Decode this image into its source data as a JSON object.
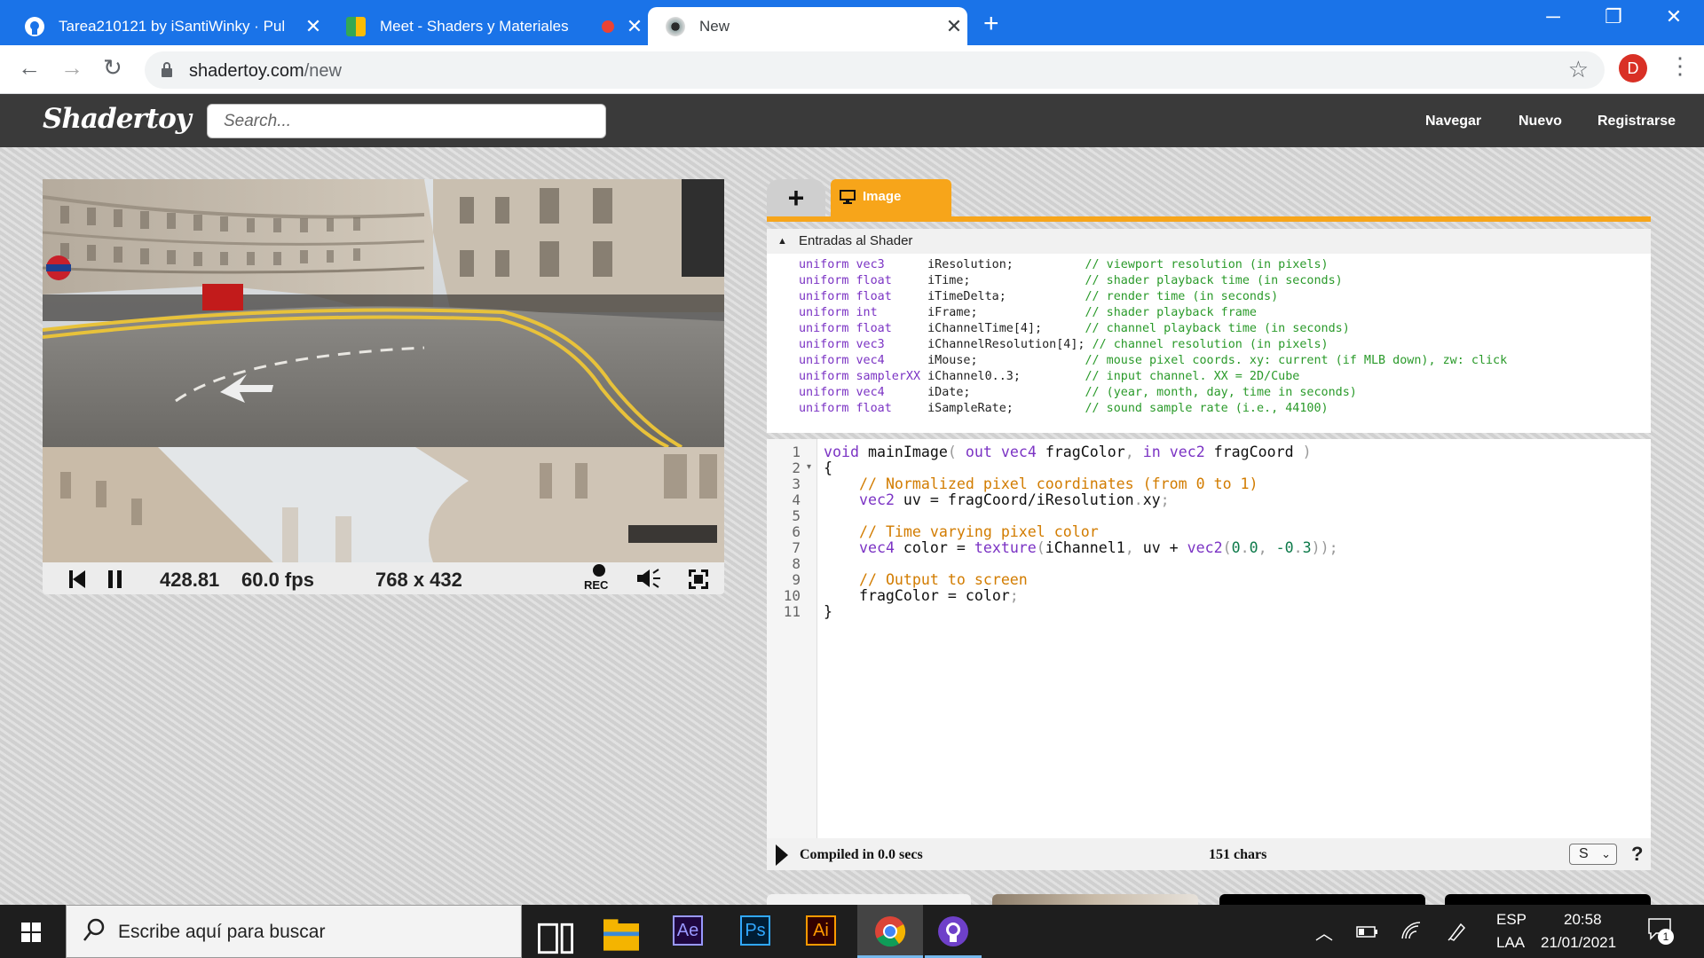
{
  "browser": {
    "tabs": [
      {
        "title": "Tarea210121 by iSantiWinky · Pul",
        "icon": "github-icon",
        "close": "✕"
      },
      {
        "title": "Meet - Shaders y Materiales",
        "icon": "google-meet-icon",
        "close": "✕"
      },
      {
        "title": "New",
        "icon": "shadertoy-icon",
        "close": "✕"
      }
    ],
    "new_tab": "+",
    "url_host": "shadertoy.com",
    "url_path": "/new",
    "profile_initial": "D"
  },
  "shadertoy": {
    "logo": "Shadertoy",
    "search_placeholder": "Search...",
    "nav": [
      "Navegar",
      "Nuevo",
      "Registrarse"
    ]
  },
  "player": {
    "time": "428.81",
    "fps": "60.0 fps",
    "resolution": "768 x 432",
    "rec_label": "REC"
  },
  "editor": {
    "add_tab": "+",
    "active_tab": "Image",
    "inputs_header": "Entradas al Shader",
    "uniforms": [
      {
        "kw": "uniform",
        "type": "vec3",
        "name": "iResolution;",
        "comment": "// viewport resolution (in pixels)"
      },
      {
        "kw": "uniform",
        "type": "float",
        "name": "iTime;",
        "comment": "// shader playback time (in seconds)"
      },
      {
        "kw": "uniform",
        "type": "float",
        "name": "iTimeDelta;",
        "comment": "// render time (in seconds)"
      },
      {
        "kw": "uniform",
        "type": "int",
        "name": "iFrame;",
        "comment": "// shader playback frame"
      },
      {
        "kw": "uniform",
        "type": "float",
        "name": "iChannelTime[4];",
        "comment": "// channel playback time (in seconds)"
      },
      {
        "kw": "uniform",
        "type": "vec3",
        "name": "iChannelResolution[4];",
        "comment": "// channel resolution (in pixels)"
      },
      {
        "kw": "uniform",
        "type": "vec4",
        "name": "iMouse;",
        "comment": "// mouse pixel coords. xy: current (if MLB down), zw: click"
      },
      {
        "kw": "uniform",
        "type": "samplerXX",
        "name": "iChannel0..3;",
        "comment": "// input channel. XX = 2D/Cube"
      },
      {
        "kw": "uniform",
        "type": "vec4",
        "name": "iDate;",
        "comment": "// (year, month, day, time in seconds)"
      },
      {
        "kw": "uniform",
        "type": "float",
        "name": "iSampleRate;",
        "comment": "// sound sample rate (i.e., 44100)"
      }
    ],
    "line_numbers": [
      "1",
      "2",
      "3",
      "4",
      "5",
      "6",
      "7",
      "8",
      "9",
      "10",
      "11"
    ],
    "code_lines": [
      "void mainImage( out vec4 fragColor, in vec2 fragCoord )",
      "{",
      "    // Normalized pixel coordinates (from 0 to 1)",
      "    vec2 uv = fragCoord/iResolution.xy;",
      "",
      "    // Time varying pixel color",
      "    vec4 color = texture(iChannel1, uv + vec2(0.0, -0.3));",
      "",
      "    // Output to screen",
      "    fragColor = color;",
      "}"
    ],
    "compiled": "Compiled in 0.0 secs",
    "chars": "151 chars",
    "select_value": "S",
    "help": "?"
  },
  "taskbar": {
    "search_placeholder": "Escribe aquí para buscar",
    "apps": [
      "task-view-icon",
      "file-explorer-icon",
      "after-effects-icon",
      "photoshop-icon",
      "illustrator-icon",
      "chrome-icon",
      "github-desktop-icon"
    ],
    "ae_label": "Ae",
    "ps_label": "Ps",
    "ai_label": "Ai",
    "lang_top": "ESP",
    "lang_bottom": "LAA",
    "time": "20:58",
    "date": "21/01/2021",
    "notif_count": "1"
  },
  "colors": {
    "chrome_blue": "#1a73e8",
    "shadertoy_orange": "#f7a51a",
    "header_dark": "#3a3a3a"
  }
}
